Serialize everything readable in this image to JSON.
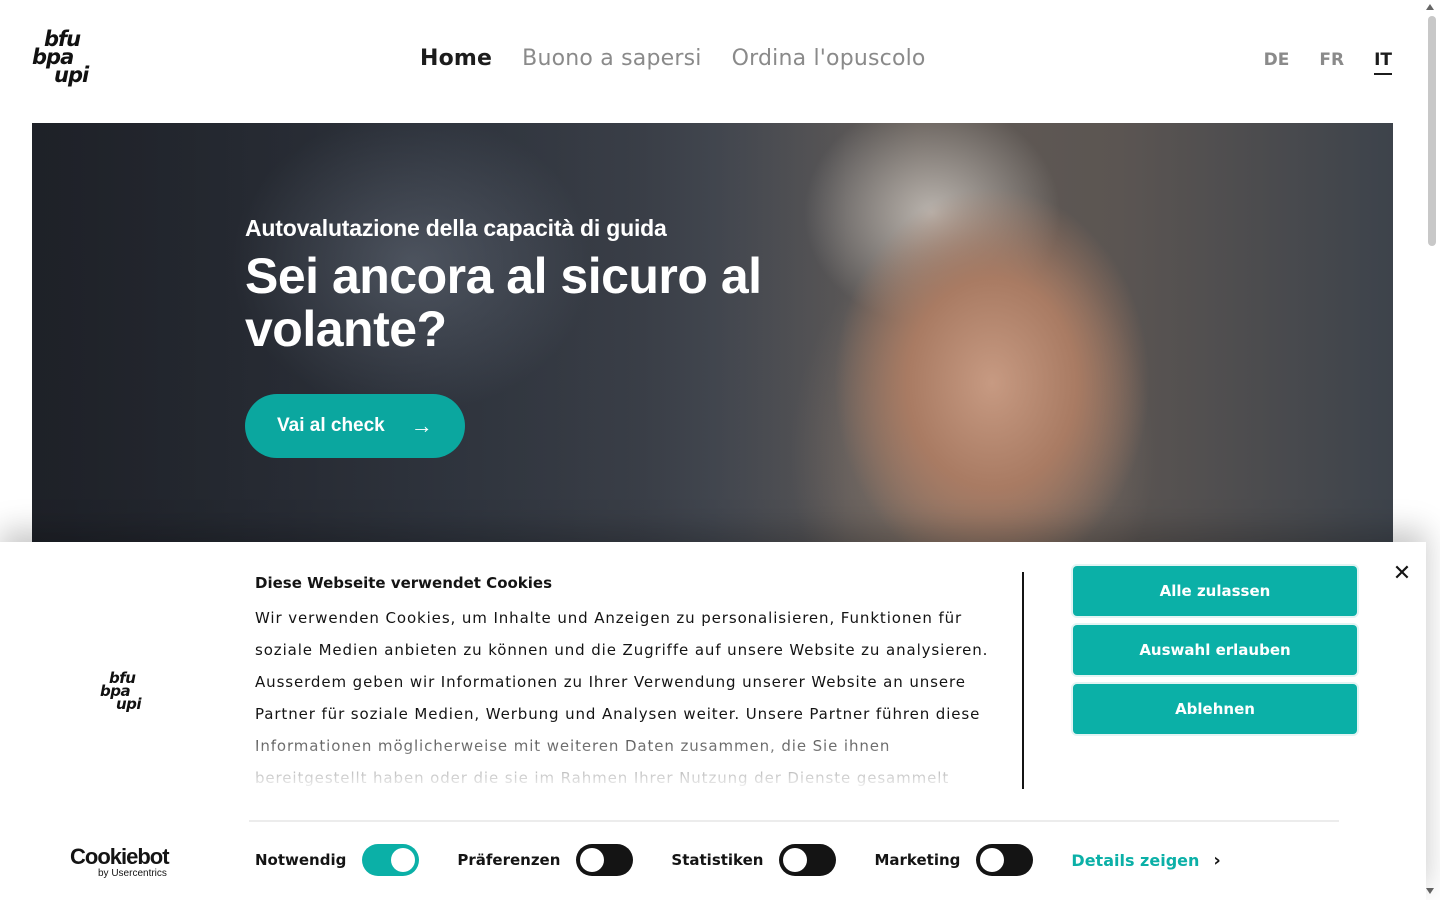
{
  "logo": {
    "line1": "bfu",
    "line2": "bpa",
    "line3": "upi"
  },
  "nav": {
    "items": [
      "Home",
      "Buono a sapersi",
      "Ordina l'opuscolo"
    ]
  },
  "langs": {
    "items": [
      "DE",
      "FR",
      "IT"
    ]
  },
  "hero": {
    "kicker": "Autovalutazione della capacità di guida",
    "title": "Sei ancora al sicuro al volante?",
    "button": "Vai al check",
    "button_icon": "arrow-right-icon"
  },
  "cookie": {
    "title": "Diese Webseite verwendet Cookies",
    "text": "Wir verwenden Cookies, um Inhalte und Anzeigen zu personalisieren, Funktionen für soziale Medien anbieten zu können und die Zugriffe auf unsere Website zu analysieren. Ausserdem geben wir Informationen zu Ihrer Verwendung unserer Website an unsere Partner für soziale Medien, Werbung und Analysen weiter. Unsere Partner führen diese Informationen möglicherweise mit weiteren Daten zusammen, die Sie ihnen bereitgestellt haben oder die sie im Rahmen Ihrer Nutzung der Dienste gesammelt haben.",
    "buttons": [
      "Alle zulassen",
      "Auswahl erlauben",
      "Ablehnen"
    ],
    "close": "✕",
    "provider": "Cookiebot",
    "provider_sub": "by Usercentrics",
    "consents": [
      {
        "label": "Notwendig",
        "checked": true
      },
      {
        "label": "Präferenzen",
        "checked": false
      },
      {
        "label": "Statistiken",
        "checked": false
      },
      {
        "label": "Marketing",
        "checked": false
      }
    ],
    "details": "Details zeigen",
    "accent": "#0bb0a7"
  }
}
